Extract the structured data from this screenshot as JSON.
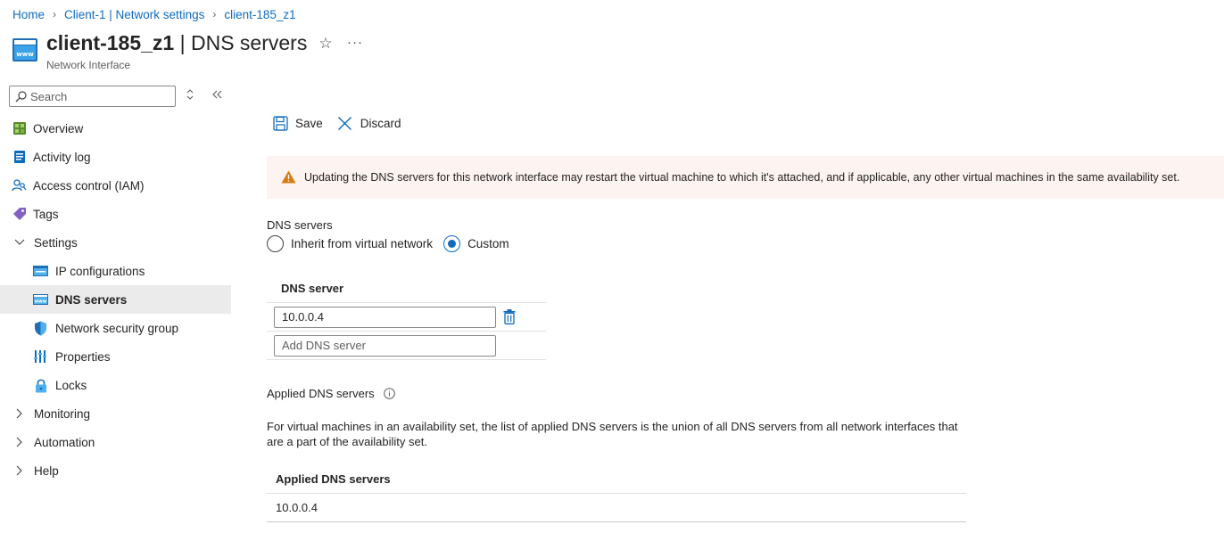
{
  "breadcrumb": [
    {
      "label": "Home"
    },
    {
      "label": "Client-1 | Network settings"
    },
    {
      "label": "client-185_z1"
    }
  ],
  "header": {
    "resource_name": "client-185_z1",
    "separator": " | ",
    "blade_name": "DNS servers",
    "subtitle": "Network Interface",
    "star_icon": "☆",
    "more_icon": "···"
  },
  "sidebar": {
    "search_placeholder": "Search",
    "items": [
      {
        "label": "Overview",
        "icon": "overview-icon"
      },
      {
        "label": "Activity log",
        "icon": "activity-log-icon"
      },
      {
        "label": "Access control (IAM)",
        "icon": "iam-icon"
      },
      {
        "label": "Tags",
        "icon": "tag-icon"
      },
      {
        "label": "Settings",
        "icon": "chevron-down-icon"
      },
      {
        "label": "IP configurations",
        "icon": "ip-config-icon"
      },
      {
        "label": "DNS servers",
        "icon": "dns-icon"
      },
      {
        "label": "Network security group",
        "icon": "shield-icon"
      },
      {
        "label": "Properties",
        "icon": "properties-icon"
      },
      {
        "label": "Locks",
        "icon": "lock-icon"
      },
      {
        "label": "Monitoring",
        "icon": "chevron-right-icon"
      },
      {
        "label": "Automation",
        "icon": "chevron-right-icon"
      },
      {
        "label": "Help",
        "icon": "chevron-right-icon"
      }
    ]
  },
  "toolbar": {
    "save_label": "Save",
    "discard_label": "Discard"
  },
  "warning": {
    "text": "Updating the DNS servers for this network interface may restart the virtual machine to which it's attached, and if applicable, any other virtual machines in the same availability set."
  },
  "dns": {
    "label": "DNS servers",
    "options": [
      "Inherit from virtual network",
      "Custom"
    ],
    "selected": "Custom",
    "table_header": "DNS server",
    "servers": [
      "10.0.0.4"
    ],
    "add_placeholder": "Add DNS server"
  },
  "applied": {
    "label": "Applied DNS servers",
    "description": "For virtual machines in an availability set, the list of applied DNS servers is the union of all DNS servers from all network interfaces that are a part of the availability set.",
    "table_header": "Applied DNS servers",
    "rows": [
      "10.0.0.4"
    ]
  },
  "colors": {
    "accent": "#0f6cbd",
    "warning_bg": "#fdf3f0",
    "warning_icon": "#da7b11",
    "active_nav_bg": "#ebebeb"
  }
}
